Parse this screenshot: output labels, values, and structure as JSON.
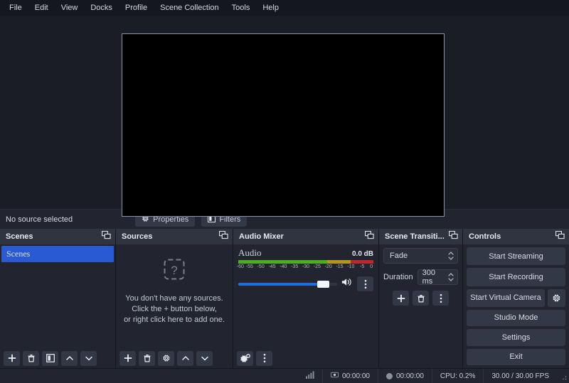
{
  "menu": {
    "items": [
      "File",
      "Edit",
      "View",
      "Docks",
      "Profile",
      "Scene Collection",
      "Tools",
      "Help"
    ]
  },
  "preview": {
    "background_color": "#000000",
    "border_color": "#8b93a8"
  },
  "source_toolbar": {
    "status": "No source selected",
    "properties_label": "Properties",
    "filters_label": "Filters"
  },
  "scenes": {
    "title": "Scenes",
    "items": [
      {
        "label": "Scenes",
        "selected": true
      }
    ],
    "selected_color": "#2a59d4",
    "buttons": [
      "add-scene",
      "remove-scene",
      "scene-filters",
      "move-scene-up",
      "move-scene-down"
    ]
  },
  "sources": {
    "title": "Sources",
    "empty_line1": "You don't have any sources.",
    "empty_line2": "Click the + button below,",
    "empty_line3": "or right click here to add one.",
    "buttons": [
      "add-source",
      "remove-source",
      "source-properties",
      "move-source-up",
      "move-source-down"
    ]
  },
  "audio_mixer": {
    "title": "Audio Mixer",
    "channel_name": "Audio",
    "db_value": "0.0 dB",
    "scale_ticks": [
      "-60",
      "-55",
      "-50",
      "-45",
      "-40",
      "-35",
      "-30",
      "-25",
      "-20",
      "-15",
      "-10",
      "-5",
      "0"
    ],
    "meter": {
      "green_pct": 66,
      "yellow_pct": 17,
      "red_pct": 17,
      "green_color": "#4caf1e",
      "yellow_color": "#b5951c",
      "red_color": "#c0272d"
    },
    "volume_pct": 90,
    "volume_fill_color": "#1d6fe0",
    "muted": false
  },
  "scene_transitions": {
    "title": "Scene Transiti...",
    "transition_value": "Fade",
    "duration_label": "Duration",
    "duration_value": "300 ms",
    "buttons": [
      "add-transition",
      "remove-transition",
      "transition-menu"
    ]
  },
  "controls": {
    "title": "Controls",
    "start_streaming": "Start Streaming",
    "start_recording": "Start Recording",
    "start_virtual_camera": "Start Virtual Camera",
    "studio_mode": "Studio Mode",
    "settings": "Settings",
    "exit": "Exit"
  },
  "statusbar": {
    "stream_time": "00:00:00",
    "record_time": "00:00:00",
    "cpu": "CPU: 0.2%",
    "fps": "30.00 / 30.00 FPS"
  }
}
